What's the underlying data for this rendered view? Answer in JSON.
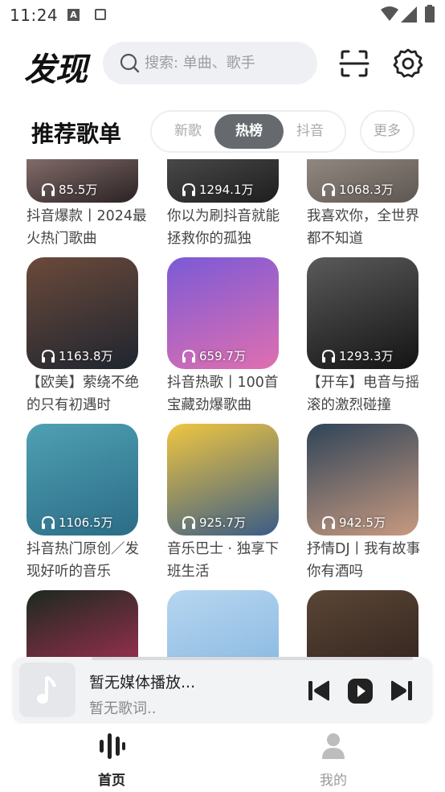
{
  "status_bar": {
    "time": "11:24",
    "notification_icon_letter": "A"
  },
  "header": {
    "app_title": "发现",
    "search_placeholder": "搜索: 单曲、歌手",
    "icons": [
      "search-icon",
      "scan-icon",
      "settings-icon"
    ]
  },
  "section": {
    "title": "推荐歌单",
    "tabs": [
      {
        "label": "新歌",
        "active": false
      },
      {
        "label": "热榜",
        "active": true
      },
      {
        "label": "抖音",
        "active": false
      }
    ],
    "more_label": "更多"
  },
  "playlists": [
    {
      "count": "85.5万",
      "title": "抖音爆款丨2024最火热门歌曲",
      "colors": [
        "#c9a7a0",
        "#2a2224"
      ]
    },
    {
      "count": "1294.1万",
      "title": "你以为刷抖音就能拯救你的孤独",
      "colors": [
        "#6a6a6a",
        "#1e1e1e"
      ]
    },
    {
      "count": "1068.3万",
      "title": "我喜欢你，全世界都不知道",
      "colors": [
        "#b9b0a8",
        "#5e5650"
      ]
    },
    {
      "count": "1163.8万",
      "title": "【欧美】萦绕不绝的只有初遇时",
      "colors": [
        "#6b4a3a",
        "#1f2530"
      ]
    },
    {
      "count": "659.7万",
      "title": "抖音热歌丨100首宝藏劲爆歌曲",
      "colors": [
        "#7b5ad6",
        "#e06fb0"
      ]
    },
    {
      "count": "1293.3万",
      "title": "【开车】电音与摇滚的激烈碰撞",
      "colors": [
        "#5a5a5a",
        "#141414"
      ]
    },
    {
      "count": "1106.5万",
      "title": "抖音热门原创／发现好听的音乐",
      "colors": [
        "#4fa0b3",
        "#2b6c86"
      ]
    },
    {
      "count": "925.7万",
      "title": "音乐巴士 · 独享下班生活",
      "colors": [
        "#f0c640",
        "#3a5c86"
      ]
    },
    {
      "count": "942.5万",
      "title": "抒情DJ丨我有故事你有酒吗",
      "colors": [
        "#2f4458",
        "#c89a80"
      ]
    },
    {
      "count": "",
      "title": "",
      "colors": [
        "#1b2a1e",
        "#c2305f"
      ]
    },
    {
      "count": "",
      "title": "",
      "colors": [
        "#b7d6f0",
        "#7fb2de"
      ]
    },
    {
      "count": "",
      "title": "",
      "colors": [
        "#5a4636",
        "#2a1c18"
      ]
    }
  ],
  "player": {
    "title": "暂无媒体播放...",
    "lyric": "暂无歌词.."
  },
  "bottom_nav": [
    {
      "label": "首页",
      "active": true
    },
    {
      "label": "我的",
      "active": false
    }
  ]
}
